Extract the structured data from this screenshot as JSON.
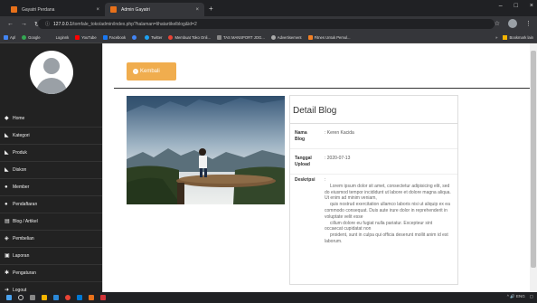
{
  "browser": {
    "tabs": [
      {
        "label": "Gayatri Perdana",
        "close": "×"
      },
      {
        "label": "Admin Gayatri",
        "close": "×"
      }
    ],
    "new_tab": "+",
    "window_controls": [
      "–",
      "□",
      "×"
    ],
    "url_host": "127.0.0.1",
    "url_path": "/tomfale_toko/admin/index.php?halaman=lihatartikelblog&id=2",
    "bookmarks": [
      {
        "label": "Apl",
        "color": "#4285f4"
      },
      {
        "label": "Google",
        "color": "#34a853"
      },
      {
        "label": "Loginnk",
        "color": "#555555"
      },
      {
        "label": "YouTube",
        "color": "#ff0000"
      },
      {
        "label": "Facebook",
        "color": "#1877f2"
      },
      {
        "label": "",
        "color": "#4285f4"
      },
      {
        "label": "Twitter",
        "color": "#1da1f2"
      },
      {
        "label": "Membuat Toko Onli...",
        "color": "#ea4335"
      },
      {
        "label": "TAS MANSPORT JOG...",
        "color": "#555555"
      },
      {
        "label": "Advertisement",
        "color": "#aaaaaa"
      },
      {
        "label": "Fitnes Untuk Pemul...",
        "color": "#f48024"
      }
    ],
    "bookmarks_more": "»",
    "bookmarks_other": "Bookmark lain"
  },
  "sidebar": {
    "items": [
      {
        "label": "Home",
        "icon": "dashboard-icon"
      },
      {
        "label": "Kategori",
        "icon": "tag-icon"
      },
      {
        "label": "Produk",
        "icon": "tag-icon"
      },
      {
        "label": "Diskon",
        "icon": "tag-icon"
      },
      {
        "label": "Member",
        "icon": "user-icon"
      },
      {
        "label": "Pendaftaran",
        "icon": "user-icon"
      },
      {
        "label": "Blog / Artikel",
        "icon": "newspaper-icon"
      },
      {
        "label": "Pembelian",
        "icon": "shield-icon"
      },
      {
        "label": "Laporan",
        "icon": "print-icon"
      },
      {
        "label": "Pengaturan",
        "icon": "gear-icon"
      },
      {
        "label": "Logout",
        "icon": "signout-icon"
      }
    ]
  },
  "main": {
    "back_button": "Kembali",
    "card_title": "Detail Blog",
    "fields": [
      {
        "label": "Nama Blog",
        "value": ": Keren Kacida"
      },
      {
        "label": "Tanggal Upload",
        "value": ": 2020-07-13"
      }
    ],
    "desc_label": "Deskripsi",
    "desc_colon": ":",
    "desc_paragraphs": [
      "Lorem ipsum dolor sit amet, consectetur adipisicing elit, sed do eiusmod tempor incididunt ut labore et dolore magna aliqua. Ut enim ad minim veniam,",
      "quis nostrud exercitation ullamco laboris nisi ut aliquip ex ea commodo consequat. Duis aute irure dolor in reprehenderit in voluptate velit esse",
      "cillum dolore eu fugiat nulla pariatur. Excepteur sint occaecat cupidatat non",
      "proident, sunt in culpa qui officia deserunt mollit anim id est laborum."
    ]
  },
  "taskbar": {
    "time": "",
    "tray": "^ 🔊 ENG"
  },
  "colors": {
    "accent": "#f0ad4e",
    "sidebar_bg": "#222222",
    "browser_bg": "#202124"
  }
}
